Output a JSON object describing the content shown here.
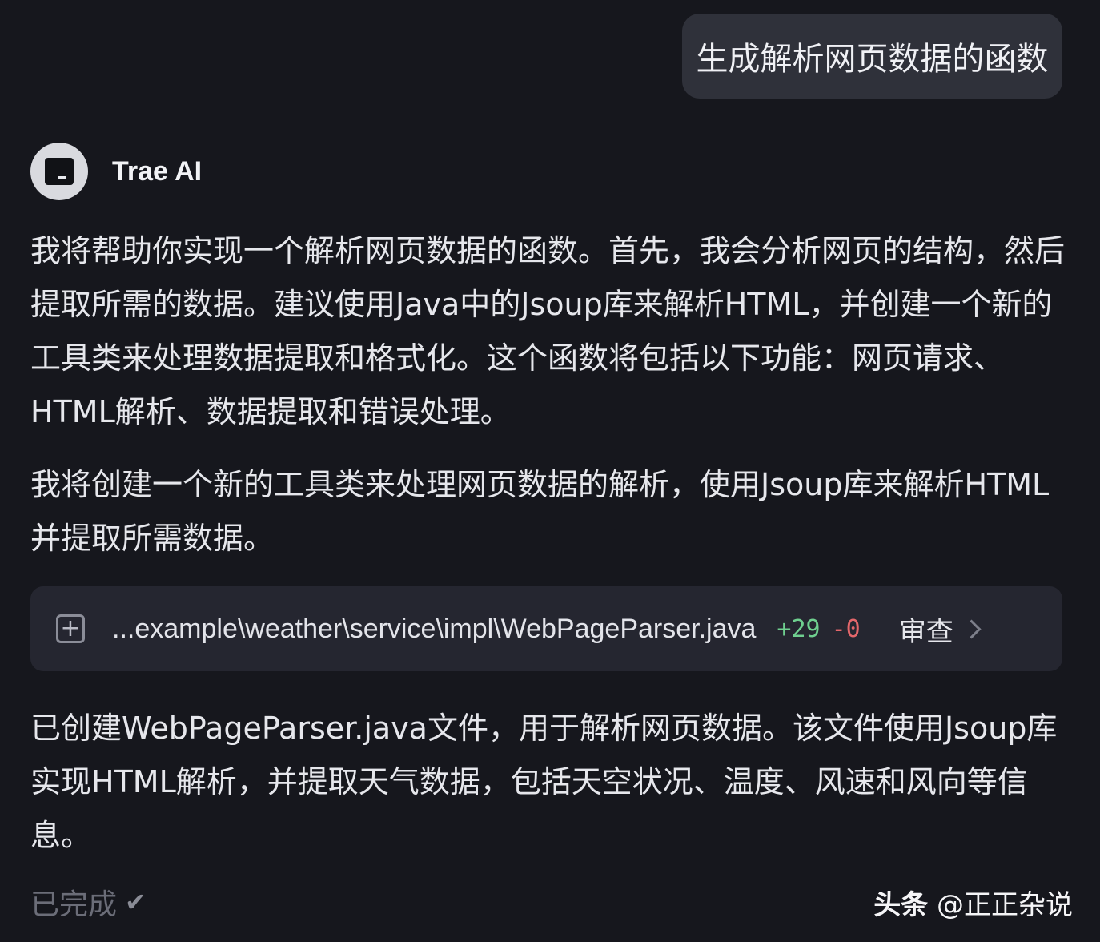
{
  "user_message": "生成解析网页数据的函数",
  "assistant": {
    "name": "Trae AI",
    "avatar_icon": "trae-logo-icon",
    "paragraph_1": "我将帮助你实现一个解析网页数据的函数。首先，我会分析网页的结构，然后提取所需的数据。建议使用Java中的Jsoup库来解析HTML，并创建一个新的工具类来处理数据提取和格式化。这个函数将包括以下功能：网页请求、HTML解析、数据提取和错误处理。",
    "paragraph_2": "我将创建一个新的工具类来处理网页数据的解析，使用Jsoup库来解析HTML并提取所需数据。",
    "paragraph_3": "已创建WebPageParser.java文件，用于解析网页数据。该文件使用Jsoup库实现HTML解析，并提取天气数据，包括天空状况、温度、风速和风向等信息。"
  },
  "file_card": {
    "icon": "plus-square-icon",
    "path": "...example\\weather\\service\\impl\\WebPageParser.java",
    "additions": "+29",
    "deletions": "-0",
    "review_label": "审查",
    "add_color": "#6fcf8f",
    "del_color": "#e4676b"
  },
  "status": {
    "label": "已完成",
    "icon": "check-icon"
  },
  "watermark": {
    "brand": "头条",
    "handle": "@正正杂说"
  }
}
